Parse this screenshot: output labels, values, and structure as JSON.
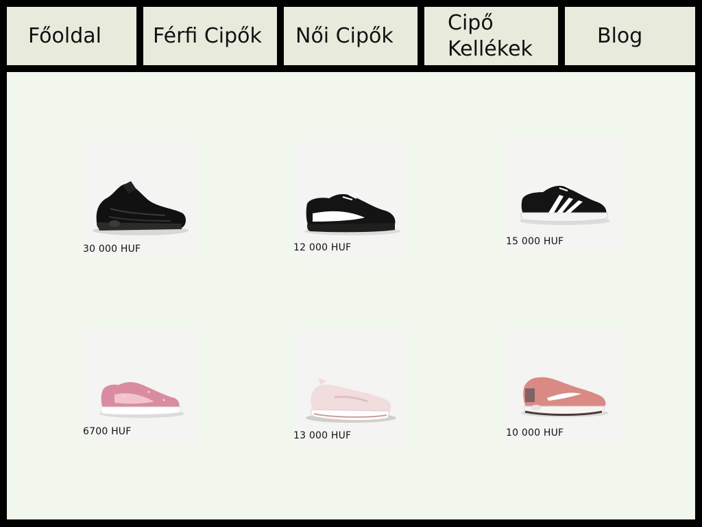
{
  "nav": {
    "items": [
      {
        "label": "Főoldal"
      },
      {
        "label": "Férfi Cipők"
      },
      {
        "label": "Női Cipők"
      },
      {
        "label": "Cipő Kellékek"
      },
      {
        "label": "Blog"
      }
    ]
  },
  "products": [
    {
      "price": "30 000 HUF",
      "image": "black-air-max-sneaker-icon"
    },
    {
      "price": "12 000 HUF",
      "image": "black-white-puma-sneaker-icon"
    },
    {
      "price": "15 000 HUF",
      "image": "black-three-stripe-sneaker-icon"
    },
    {
      "price": "6700 HUF",
      "image": "pink-glitter-sneaker-icon"
    },
    {
      "price": "13 000 HUF",
      "image": "pale-pink-air-sneaker-icon"
    },
    {
      "price": "10 000 HUF",
      "image": "pink-air-max-sneaker-icon"
    }
  ],
  "colors": {
    "nav_background": "#e8ebdc",
    "content_background": "#f1f7ec",
    "frame": "#000000"
  }
}
